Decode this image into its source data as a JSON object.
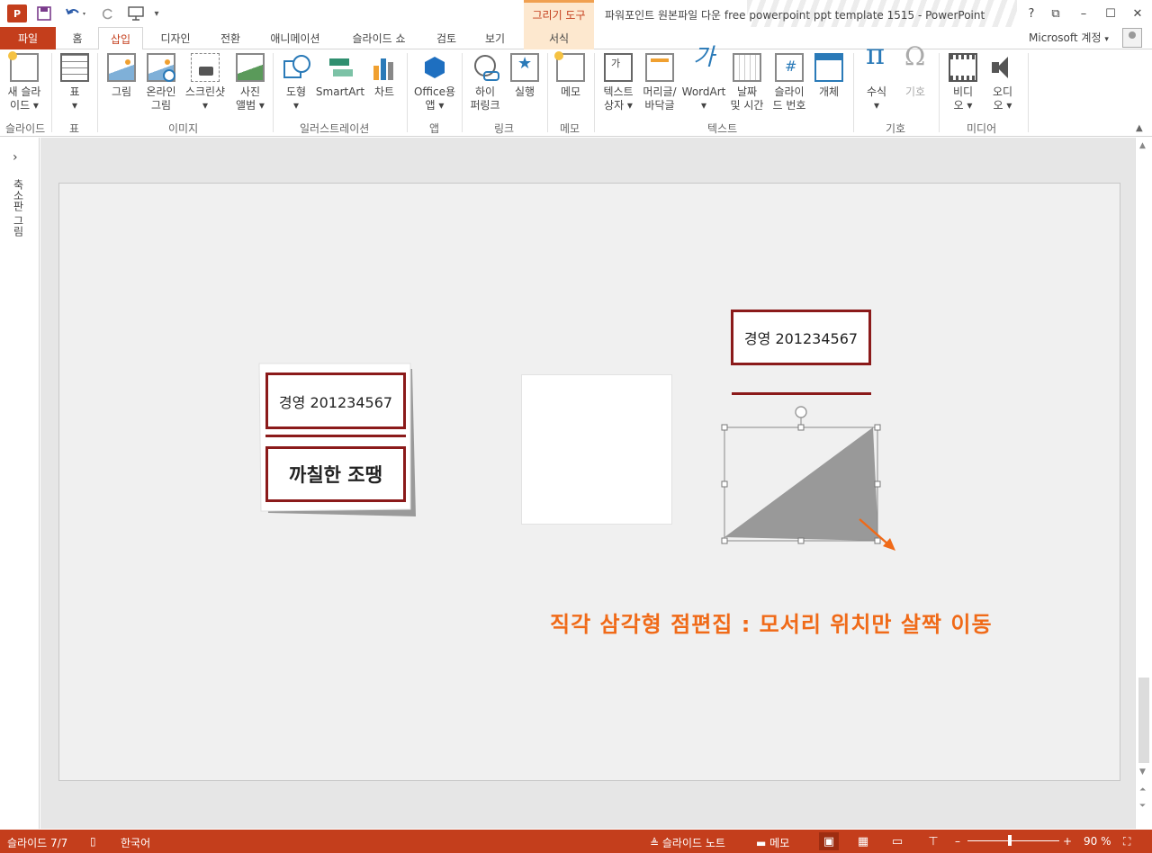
{
  "titlebar": {
    "app_logo": "P",
    "tools_header": "그리기 도구",
    "window_title": "파워포인트 원본파일 다운 free powerpoint ppt template 1515 - PowerPoint",
    "help": "?",
    "restore_ribbon": "⧉",
    "minimize": "–",
    "maximize": "☐",
    "close": "✕"
  },
  "tabs": {
    "file": "파일",
    "home": "홈",
    "insert": "삽입",
    "design": "디자인",
    "transitions": "전환",
    "animations": "애니메이션",
    "slideshow": "슬라이드 쇼",
    "review": "검토",
    "view": "보기",
    "format": "서식",
    "account": "Microsoft 계정"
  },
  "ribbon": {
    "new_slide": "새 슬라\n이드 ▾",
    "table": "표\n▾",
    "pictures": "그림",
    "online_pictures": "온라인\n그림",
    "screenshot": "스크린샷\n▾",
    "photo_album": "사진\n앨범 ▾",
    "shapes": "도형\n▾",
    "smartart": "SmartArt",
    "chart": "차트",
    "office_apps": "Office용\n앱 ▾",
    "hyperlink": "하이\n퍼링크",
    "action": "실행",
    "comment": "메모",
    "textbox": "텍스트\n상자 ▾",
    "header_footer": "머리글/\n바닥글",
    "wordart": "WordArt\n▾",
    "date_time": "날짜\n및 시간",
    "slide_number": "슬라이\n드 번호",
    "object": "개체",
    "equation": "수식\n▾",
    "symbol": "기호",
    "video": "비디\n오 ▾",
    "audio": "오디\n오 ▾",
    "groups": {
      "slides": "슬라이드",
      "tables": "표",
      "images": "이미지",
      "illustrations": "일러스트레이션",
      "apps": "앱",
      "links": "링크",
      "comments": "메모",
      "text": "텍스트",
      "symbols": "기호",
      "media": "미디어"
    }
  },
  "left_pane": {
    "toggle": "›",
    "label": "축소판 그림"
  },
  "slide": {
    "card_left_name": "경영 201234567",
    "card_left_title": "까칠한 조땡",
    "card_right_name": "경영 201234567",
    "caption": "직각 삼각형 점편집 : 모서리 위치만 살짝 이동",
    "caption_color": "#f06a18",
    "accent_color": "#8b1a1a",
    "triangle_color": "#999999"
  },
  "statusbar": {
    "slide_counter": "슬라이드 7/7",
    "language": "한국어",
    "notes": "≜ 슬라이드 노트",
    "comments": "▬ 메모",
    "zoom_minus": "–",
    "zoom_plus": "+",
    "zoom": "90 %"
  },
  "colors": {
    "brand": "#c43e1c",
    "tools_tab_bg": "#fde8cf"
  }
}
